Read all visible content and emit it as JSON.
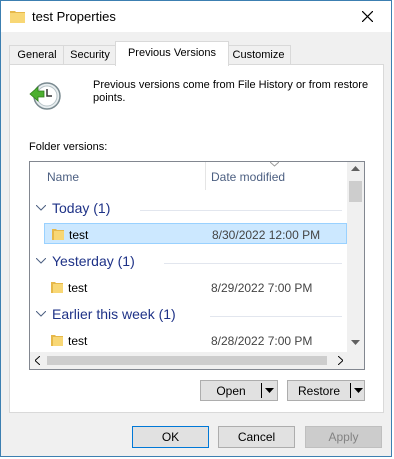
{
  "window": {
    "title": "test Properties",
    "close_glyph": "close-icon"
  },
  "tabs": [
    {
      "label": "General",
      "active": false
    },
    {
      "label": "Security",
      "active": false
    },
    {
      "label": "Previous Versions",
      "active": true
    },
    {
      "label": "Customize",
      "active": false
    }
  ],
  "panel": {
    "description": "Previous versions come from File History or from restore points.",
    "folder_versions_label": "Folder versions:"
  },
  "list": {
    "columns": {
      "name": "Name",
      "date": "Date modified"
    },
    "groups": [
      {
        "label": "Today (1)",
        "items": [
          {
            "name": "test",
            "date": "8/30/2022 12:00 PM",
            "selected": true
          }
        ]
      },
      {
        "label": "Yesterday (1)",
        "items": [
          {
            "name": "test",
            "date": "8/29/2022 7:00 PM",
            "selected": false
          }
        ]
      },
      {
        "label": "Earlier this week (1)",
        "items": [
          {
            "name": "test",
            "date": "8/28/2022 7:00 PM",
            "selected": false
          }
        ]
      }
    ]
  },
  "actions": {
    "open_label": "Open",
    "restore_label": "Restore"
  },
  "dialog_buttons": {
    "ok": "OK",
    "cancel": "Cancel",
    "apply": "Apply"
  },
  "colors": {
    "accent": "#0078d7",
    "group_text": "#1e3287",
    "selection": "#cce8ff",
    "folder": "#f8d775"
  }
}
